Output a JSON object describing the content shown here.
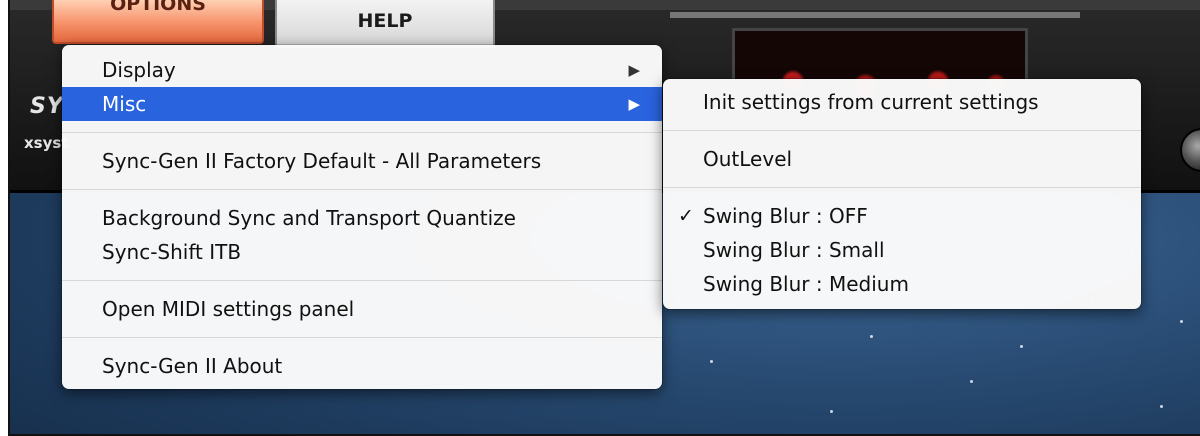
{
  "header": {
    "options_tab": "OPTIONS",
    "help_tab": "HELP",
    "brand": "SY",
    "brand_sub": "xsyst"
  },
  "options_menu": {
    "items": [
      {
        "label": "Display",
        "has_submenu": true,
        "highlighted": false
      },
      {
        "label": "Misc",
        "has_submenu": true,
        "highlighted": true
      },
      {
        "label": "Sync-Gen II Factory Default - All Parameters"
      },
      {
        "label": "Background Sync and Transport Quantize"
      },
      {
        "label": "Sync-Shift ITB"
      },
      {
        "label": "Open MIDI settings panel"
      },
      {
        "label": "Sync-Gen II About"
      }
    ],
    "submenu_arrow": "▶"
  },
  "misc_submenu": {
    "items": [
      {
        "label": "Init settings from current settings",
        "checked": false
      },
      {
        "label": "OutLevel",
        "checked": false
      },
      {
        "label": "Swing Blur : OFF",
        "checked": true
      },
      {
        "label": "Swing Blur : Small",
        "checked": false
      },
      {
        "label": "Swing Blur : Medium",
        "checked": false
      }
    ],
    "check_mark": "✓"
  },
  "colors": {
    "highlight": "#2a63de",
    "options_tab": "#f6926a"
  },
  "icons": [
    "chevron-right-icon",
    "checkmark-icon",
    "knob"
  ]
}
